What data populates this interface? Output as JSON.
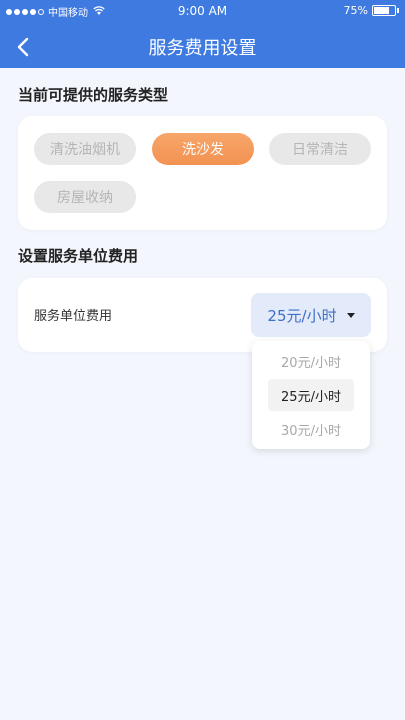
{
  "status_bar": {
    "carrier": "中国移动",
    "time": "9:00 AM",
    "battery": "75%",
    "battery_level": 0.75
  },
  "nav": {
    "back_icon": "chevron-left-icon",
    "title": "服务费用设置"
  },
  "service_types": {
    "title": "当前可提供的服务类型",
    "items": [
      {
        "label": "清洗油烟机",
        "active": false
      },
      {
        "label": "洗沙发",
        "active": true
      },
      {
        "label": "日常清洁",
        "active": false
      },
      {
        "label": "房屋收纳",
        "active": false
      }
    ]
  },
  "fee": {
    "title": "设置服务单位费用",
    "label": "服务单位费用",
    "selected": "25元/小时",
    "options": [
      "20元/小时",
      "25元/小时",
      "30元/小时"
    ],
    "selected_index": 1
  },
  "colors": {
    "header": "#3f7ae0",
    "accent": "#f29252",
    "select_text": "#3f6fc6"
  }
}
